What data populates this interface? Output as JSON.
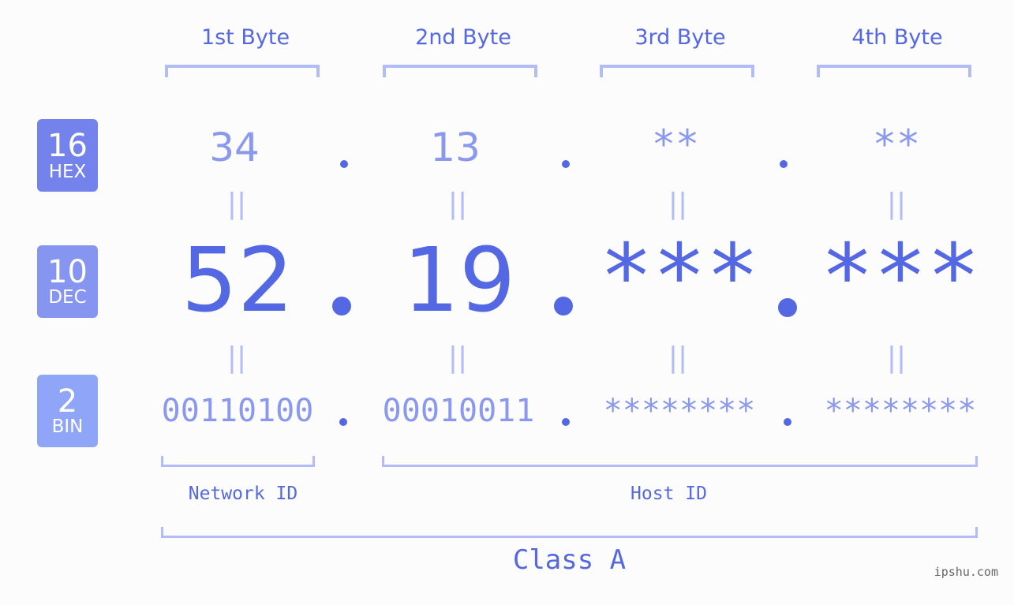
{
  "colors": {
    "accent": "#5468e4",
    "light_accent": "#8a98ee",
    "bracket": "#b2bcf7",
    "hex_badge": "#7383eb",
    "dec_badge": "#8595f0",
    "bin_badge": "#8fa6f8",
    "background": "#fbfcfb"
  },
  "byte_headers": [
    "1st Byte",
    "2nd Byte",
    "3rd Byte",
    "4th Byte"
  ],
  "badges": {
    "hex": {
      "number": "16",
      "label": "HEX"
    },
    "dec": {
      "number": "10",
      "label": "DEC"
    },
    "bin": {
      "number": "2",
      "label": "BIN"
    }
  },
  "hex_values": [
    "34",
    "13",
    "**",
    "**"
  ],
  "dec_values": [
    "52",
    "19",
    "***",
    "***"
  ],
  "bin_values": [
    "00110100",
    "00010011",
    "********",
    "********"
  ],
  "equals_symbol": "||",
  "segments": {
    "network_id": "Network ID",
    "host_id": "Host ID"
  },
  "ip_class": "Class A",
  "watermark": "ipshu.com"
}
